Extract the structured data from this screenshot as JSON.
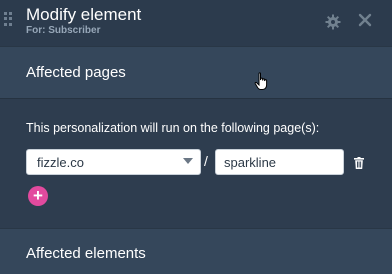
{
  "header": {
    "title": "Modify element",
    "subtitle": "For: Subscriber",
    "icons": {
      "drag": "drag-handle-icon",
      "settings": "gear-icon",
      "close": "close-icon"
    }
  },
  "pages_section": {
    "title": "Affected pages",
    "description": "This personalization will run on the following page(s):",
    "domain_value": "fizzle.co",
    "separator": "/",
    "path_value": "sparkline",
    "icons": {
      "delete": "trash-icon",
      "add": "plus-icon"
    }
  },
  "elements_section": {
    "title": "Affected elements"
  },
  "colors": {
    "background": "#2e3d4f",
    "section_bar": "#35475b",
    "add_button": "#e24a9e"
  }
}
